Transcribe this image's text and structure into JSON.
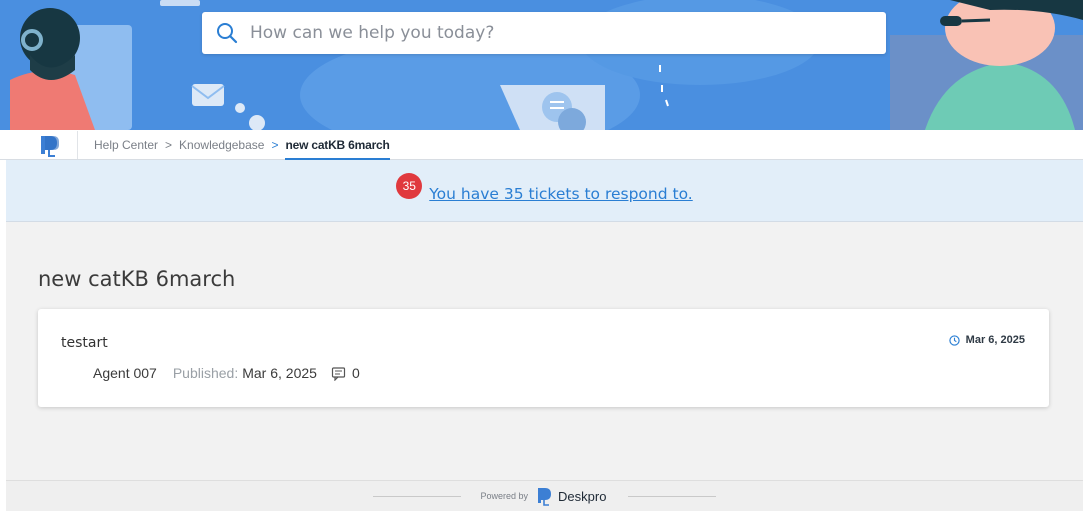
{
  "search": {
    "placeholder": "How can we help you today?"
  },
  "breadcrumb": {
    "items": [
      "Help Center",
      "Knowledgebase",
      "new catKB 6march"
    ],
    "separator": ">"
  },
  "alert": {
    "count": "35",
    "text": "You have 35 tickets to respond to."
  },
  "page": {
    "title": "new catKB 6march"
  },
  "articles": [
    {
      "title": "testart",
      "author": "Agent 007",
      "published_label": "Published:",
      "published_date": "Mar 6, 2025",
      "comments": "0",
      "date": "Mar 6, 2025"
    }
  ],
  "footer": {
    "powered_by": "Powered by",
    "brand": "Deskpro"
  },
  "icons": {
    "search": "search-icon",
    "logo": "deskpro-logo-icon",
    "clock": "clock-icon",
    "comment": "comment-icon"
  },
  "colors": {
    "banner": "#4a90e2",
    "accent": "#2a7ed3",
    "badge": "#e0393e",
    "alert_bg": "#e2eef9",
    "main_bg": "#f2f2f2"
  }
}
